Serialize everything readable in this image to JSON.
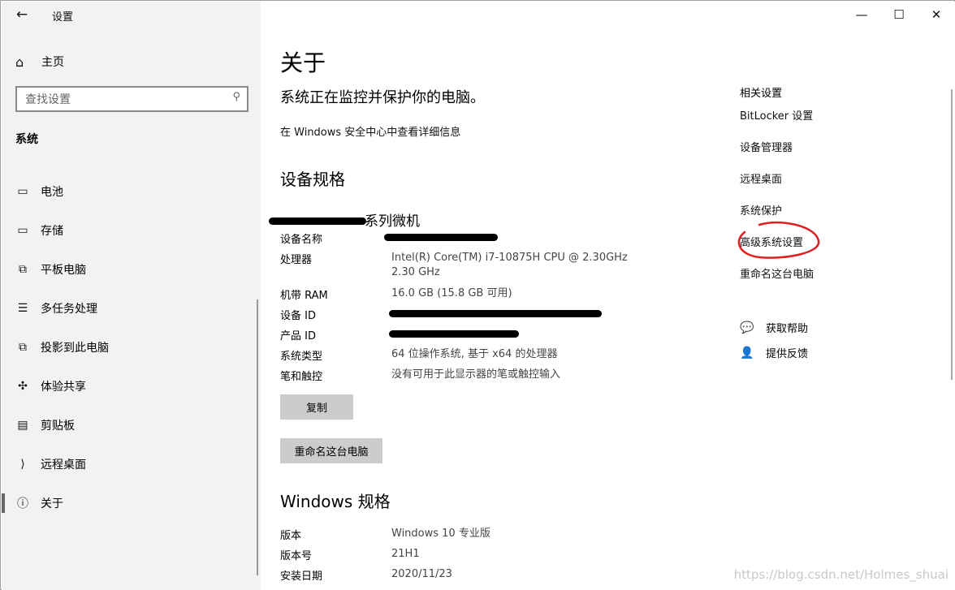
{
  "window": {
    "app_title": "设置",
    "back": "←",
    "minimize": "—",
    "maximize": "☐",
    "close": "✕"
  },
  "sidebar": {
    "home": "主页",
    "search_placeholder": "查找设置",
    "section": "系统",
    "items": [
      {
        "label": "电池",
        "icon": "battery-icon",
        "glyph": "▭"
      },
      {
        "label": "存储",
        "icon": "storage-icon",
        "glyph": "▭"
      },
      {
        "label": "平板电脑",
        "icon": "tablet-icon",
        "glyph": "⧉"
      },
      {
        "label": "多任务处理",
        "icon": "multitask-icon",
        "glyph": "☰"
      },
      {
        "label": "投影到此电脑",
        "icon": "project-icon",
        "glyph": "⧉"
      },
      {
        "label": "体验共享",
        "icon": "share-icon",
        "glyph": "✣"
      },
      {
        "label": "剪贴板",
        "icon": "clipboard-icon",
        "glyph": "▤"
      },
      {
        "label": "远程桌面",
        "icon": "remote-icon",
        "glyph": "⟩"
      },
      {
        "label": "关于",
        "icon": "info-icon",
        "glyph": "ⓘ"
      }
    ]
  },
  "main": {
    "title": "关于",
    "protect_text": "系统正在监控并保护你的电脑。",
    "security_link": "在 Windows 安全中心中查看详细信息",
    "device_heading": "设备规格",
    "model": "系列微机",
    "specs": [
      {
        "key": "设备名称",
        "value": ""
      },
      {
        "key": "处理器",
        "value": "Intel(R) Core(TM) i7-10875H CPU @ 2.30GHz   2.30 GHz"
      },
      {
        "key": "机带 RAM",
        "value": "16.0 GB (15.8 GB 可用)"
      },
      {
        "key": "设备 ID",
        "value": ""
      },
      {
        "key": "产品 ID",
        "value": ""
      },
      {
        "key": "系统类型",
        "value": "64 位操作系统, 基于 x64 的处理器"
      },
      {
        "key": "笔和触控",
        "value": "没有可用于此显示器的笔或触控输入"
      }
    ],
    "copy_button": "复制",
    "rename_button": "重命名这台电脑",
    "windows_heading": "Windows 规格",
    "win_specs": [
      {
        "key": "版本",
        "value": "Windows 10 专业版"
      },
      {
        "key": "版本号",
        "value": "21H1"
      },
      {
        "key": "安装日期",
        "value": "2020/11/23"
      }
    ]
  },
  "related": {
    "title": "相关设置",
    "links": [
      "BitLocker 设置",
      "设备管理器",
      "远程桌面",
      "系统保护",
      "高级系统设置",
      "重命名这台电脑"
    ],
    "help": "获取帮助",
    "feedback": "提供反馈"
  },
  "watermark": "https://blog.csdn.net/Holmes_shuai",
  "colors": {
    "annotation_circle": "#e02020",
    "sidebar_bg": "#f2f2f2",
    "button_bg": "#cccccc"
  }
}
